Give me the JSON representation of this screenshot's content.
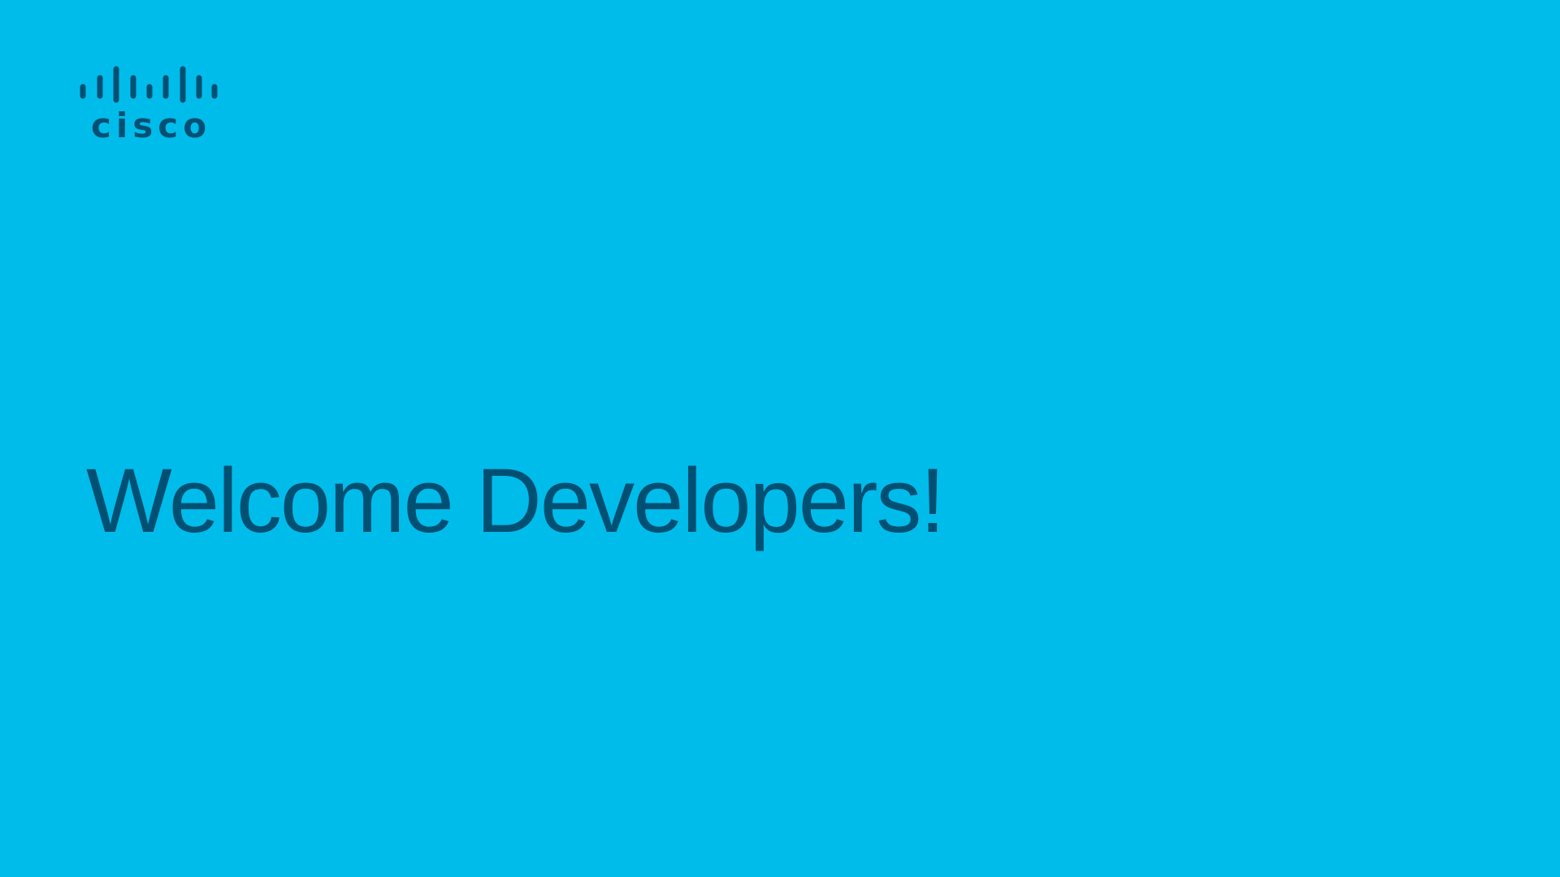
{
  "slide": {
    "background_color": "#00BCEB",
    "text_color": "#005073"
  },
  "logo": {
    "icon": "cisco-bridge-logo-icon",
    "wordmark": "cisco"
  },
  "headline": {
    "text": "Welcome Developers!"
  }
}
